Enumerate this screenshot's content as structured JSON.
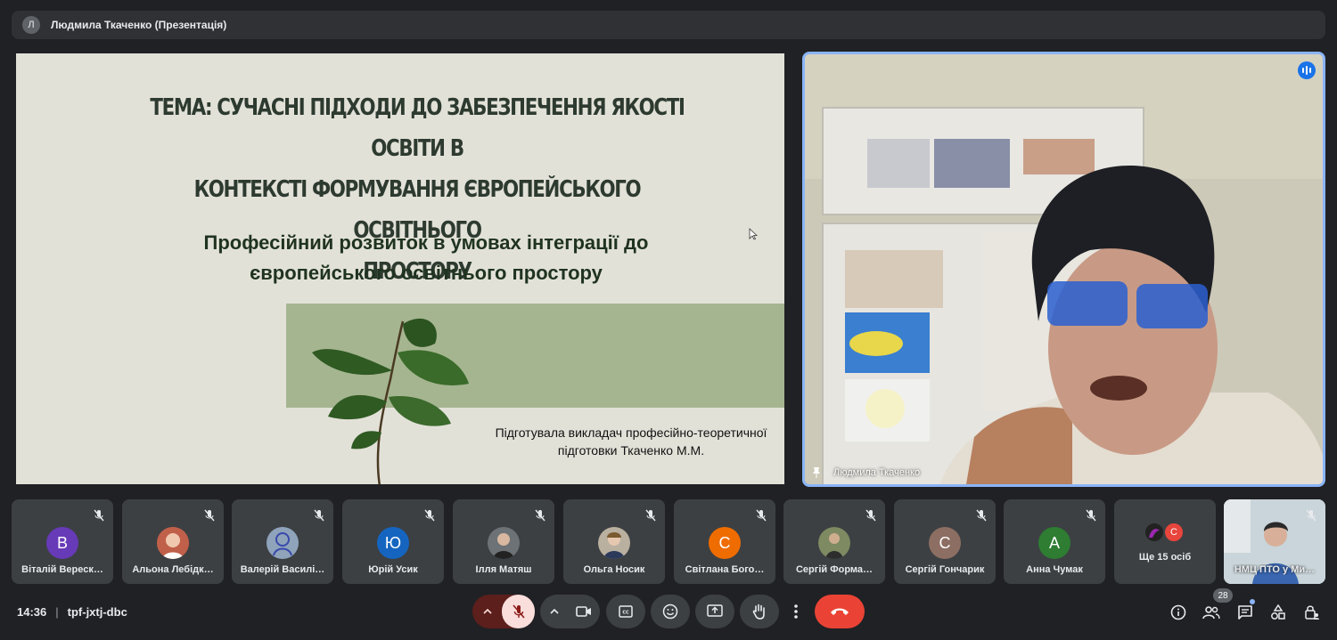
{
  "presenter_bar": {
    "avatar_letter": "Л",
    "title": "Людмила Ткаченко (Презентація)"
  },
  "slide": {
    "title_lines": [
      "ТЕМА: СУЧАСНІ ПІДХОДИ ДО ЗАБЕЗПЕЧЕННЯ ЯКОСТІ ОСВІТИ В",
      "КОНТЕКСТІ ФОРМУВАННЯ ЄВРОПЕЙСЬКОГО ОСВІТНЬОГО",
      "ПРОСТОРУ"
    ],
    "subtitle_lines": [
      "Професійний розвиток в умовах інтеграції до",
      "європейського освітнього простору"
    ],
    "author_lines": [
      "Підготувала викладач професійно-теоретичної",
      "підготовки Ткаченко М.М."
    ],
    "colors": {
      "background": "#e2e1d8",
      "accent_block": "#a5b590",
      "title": "#2d3a2f"
    }
  },
  "speaker": {
    "name": "Людмила Ткаченко",
    "speaking_icon": "audio-level-icon",
    "pin_icon": "pin-icon"
  },
  "participants": [
    {
      "name": "Віталій Вереск…",
      "avatar_letter": "В",
      "avatar_color": "#673ab7",
      "avatar_type": "letter"
    },
    {
      "name": "Альона Лебідк…",
      "avatar_letter": "",
      "avatar_color": "#c0604a",
      "avatar_type": "photo"
    },
    {
      "name": "Валерій Василі…",
      "avatar_letter": "",
      "avatar_color": "#7b8fa6",
      "avatar_type": "photo"
    },
    {
      "name": "Юрій Усик",
      "avatar_letter": "Ю",
      "avatar_color": "#1565c0",
      "avatar_type": "letter"
    },
    {
      "name": "Ілля Матяш",
      "avatar_letter": "",
      "avatar_color": "#555b61",
      "avatar_type": "photo"
    },
    {
      "name": "Ольга Носик",
      "avatar_letter": "",
      "avatar_color": "#8a7a6a",
      "avatar_type": "photo"
    },
    {
      "name": "Світлана Бого…",
      "avatar_letter": "С",
      "avatar_color": "#ef6c00",
      "avatar_type": "letter"
    },
    {
      "name": "Сергій Форма…",
      "avatar_letter": "",
      "avatar_color": "#4e5a40",
      "avatar_type": "photo"
    },
    {
      "name": "Сергій Гончарик",
      "avatar_letter": "С",
      "avatar_color": "#8d6e63",
      "avatar_type": "letter"
    },
    {
      "name": "Анна Чумак",
      "avatar_letter": "А",
      "avatar_color": "#2e7d32",
      "avatar_type": "letter"
    }
  ],
  "more_tile": {
    "label": "Ще 15 осіб",
    "second_letter": "С"
  },
  "self_tile": {
    "name": "НМЦ ПТО у Ми…"
  },
  "bottom_bar": {
    "time": "14:36",
    "separator": "|",
    "meeting_code": "tpf-jxtj-dbc",
    "participant_count": "28",
    "colors": {
      "mic_off": "#f9dedc",
      "mic_off_bg": "#8c1d18",
      "end_call": "#ea4335"
    }
  }
}
